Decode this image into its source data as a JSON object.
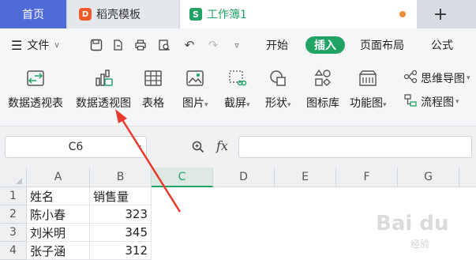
{
  "tabs": {
    "home": "首页",
    "docer": "稻壳模板",
    "book": "工作簿1",
    "plus": "+"
  },
  "menu": {
    "file": "文件",
    "start": "开始",
    "insert": "插入",
    "layout": "页面布局",
    "formula": "公式"
  },
  "ribbon": {
    "pivot_table": "数据透视表",
    "pivot_chart": "数据透视图",
    "table": "表格",
    "picture": "图片",
    "screenshot": "截屏",
    "shape": "形状",
    "icon_lib": "图标库",
    "func_chart": "功能图",
    "mindmap": "思维导图",
    "flowchart": "流程图"
  },
  "formula_bar": {
    "cell_ref": "C6",
    "fx": "fx"
  },
  "columns": [
    "A",
    "B",
    "C",
    "D",
    "E",
    "F",
    "G"
  ],
  "rows": [
    {
      "num": "1",
      "a": "姓名",
      "b": "销售量"
    },
    {
      "num": "2",
      "a": "陈小春",
      "b": "323"
    },
    {
      "num": "3",
      "a": "刘米明",
      "b": "345"
    },
    {
      "num": "4",
      "a": "张子涵",
      "b": "312"
    }
  ],
  "selected_column": "C",
  "colors": {
    "accent": "#21a366",
    "home_tab": "#4f6bd8",
    "arrow": "#e83a2f"
  },
  "watermark": {
    "main": "Bai du",
    "sub": "经验"
  }
}
